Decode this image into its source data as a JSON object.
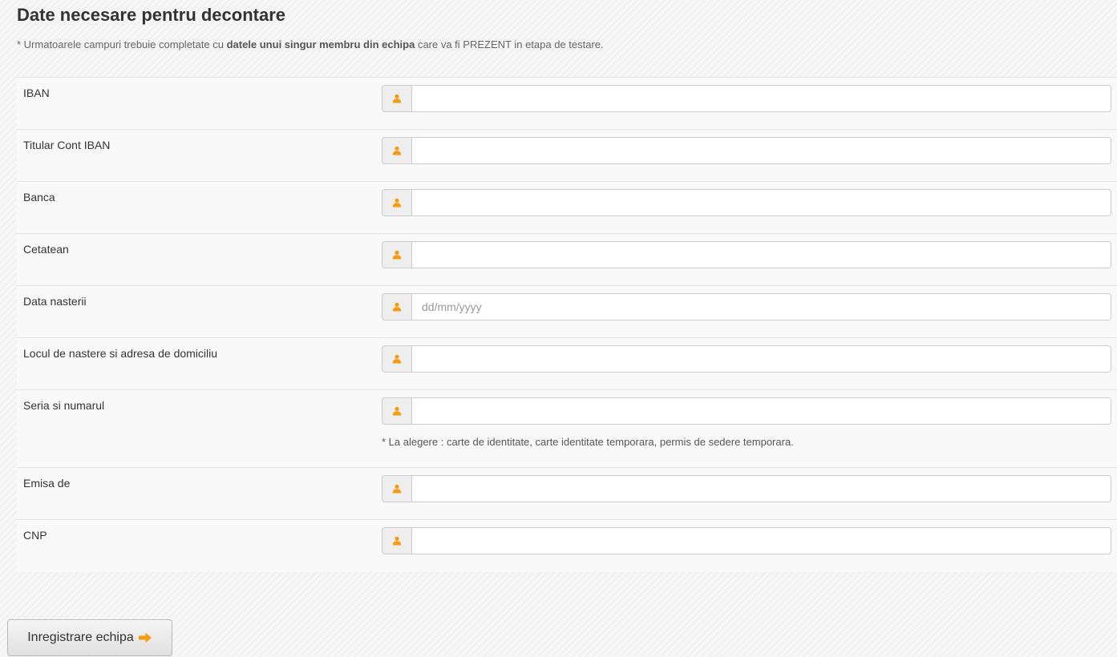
{
  "page": {
    "title": "Date necesare pentru decontare",
    "note_prefix": "* Urmatoarele campuri trebuie completate cu ",
    "note_bold": "datele unui singur membru din echipa",
    "note_suffix": " care va fi PREZENT in etapa de testare."
  },
  "colors": {
    "accent": "#f39c12",
    "addon_bg": "#eeeeee",
    "border": "#cccccc"
  },
  "icons": {
    "field_addon": "user-icon",
    "submit": "arrow-right-icon"
  },
  "fields": [
    {
      "label": "IBAN",
      "value": "",
      "placeholder": ""
    },
    {
      "label": "Titular Cont IBAN",
      "value": "",
      "placeholder": ""
    },
    {
      "label": "Banca",
      "value": "",
      "placeholder": ""
    },
    {
      "label": "Cetatean",
      "value": "",
      "placeholder": ""
    },
    {
      "label": "Data nasterii",
      "value": "",
      "placeholder": "dd/mm/yyyy"
    },
    {
      "label": "Locul de nastere si adresa de domiciliu",
      "value": "",
      "placeholder": ""
    },
    {
      "label": "Seria si numarul",
      "value": "",
      "placeholder": "",
      "help": "* La alegere : carte de identitate, carte identitate temporara, permis de sedere temporara."
    },
    {
      "label": "Emisa de",
      "value": "",
      "placeholder": ""
    },
    {
      "label": "CNP",
      "value": "",
      "placeholder": ""
    }
  ],
  "submit": {
    "label": "Inregistrare echipa"
  }
}
